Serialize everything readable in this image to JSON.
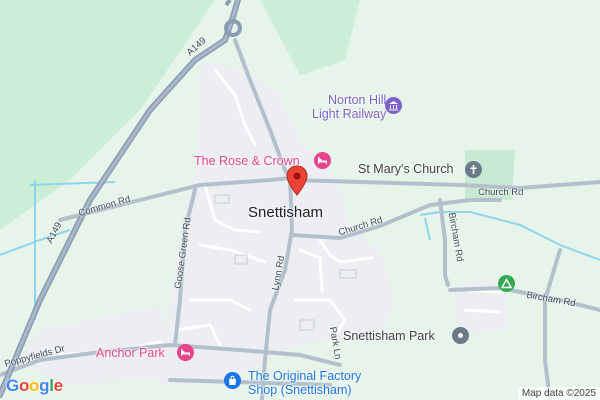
{
  "town": "Snettisham",
  "roads": {
    "a149_top": "A149",
    "a149_bottom": "A149",
    "common_rd": "Common Rd",
    "goose_green_rd": "Goose Green Rd",
    "lynn_rd": "Lynn Rd",
    "church_rd_main": "Church Rd",
    "church_rd_east": "Church Rd",
    "bircham_rd_vertical": "Bircham Rd",
    "bircham_rd_east": "Bircham Rd",
    "park_ln": "Park Ln",
    "poppyfields_dr": "Poppyfields Dr"
  },
  "pois": {
    "norton_hill": {
      "line1": "Norton Hill",
      "line2": "Light Railway",
      "icon": "museum-icon",
      "color": "#7b61c9"
    },
    "rose_crown": {
      "label": "The Rose & Crown",
      "icon": "bed-icon",
      "color": "#e8438b"
    },
    "st_marys": {
      "label": "St Mary's Church",
      "icon": "church-cross-icon",
      "color": "#6b7b8a"
    },
    "snettisham_park": {
      "label": "Snettisham Park",
      "icon": "generic-poi-icon",
      "color": "#6b7b8a"
    },
    "anchor_park": {
      "label": "Anchor Park",
      "icon": "bed-icon",
      "color": "#e8438b"
    },
    "factory_shop": {
      "line1": "The Original Factory",
      "line2": "Shop (Snettisham)",
      "icon": "shopping-bag-icon",
      "color": "#1a73e8"
    },
    "campsite": {
      "icon": "campsite-icon",
      "color": "#34a853"
    }
  },
  "marker": {
    "icon": "red-pin-icon",
    "color": "#ea4335"
  },
  "attribution": "Map data ©2025",
  "logo": {
    "g1": "G",
    "o1": "o",
    "o2": "o",
    "g2": "g",
    "l": "l",
    "e": "e"
  }
}
